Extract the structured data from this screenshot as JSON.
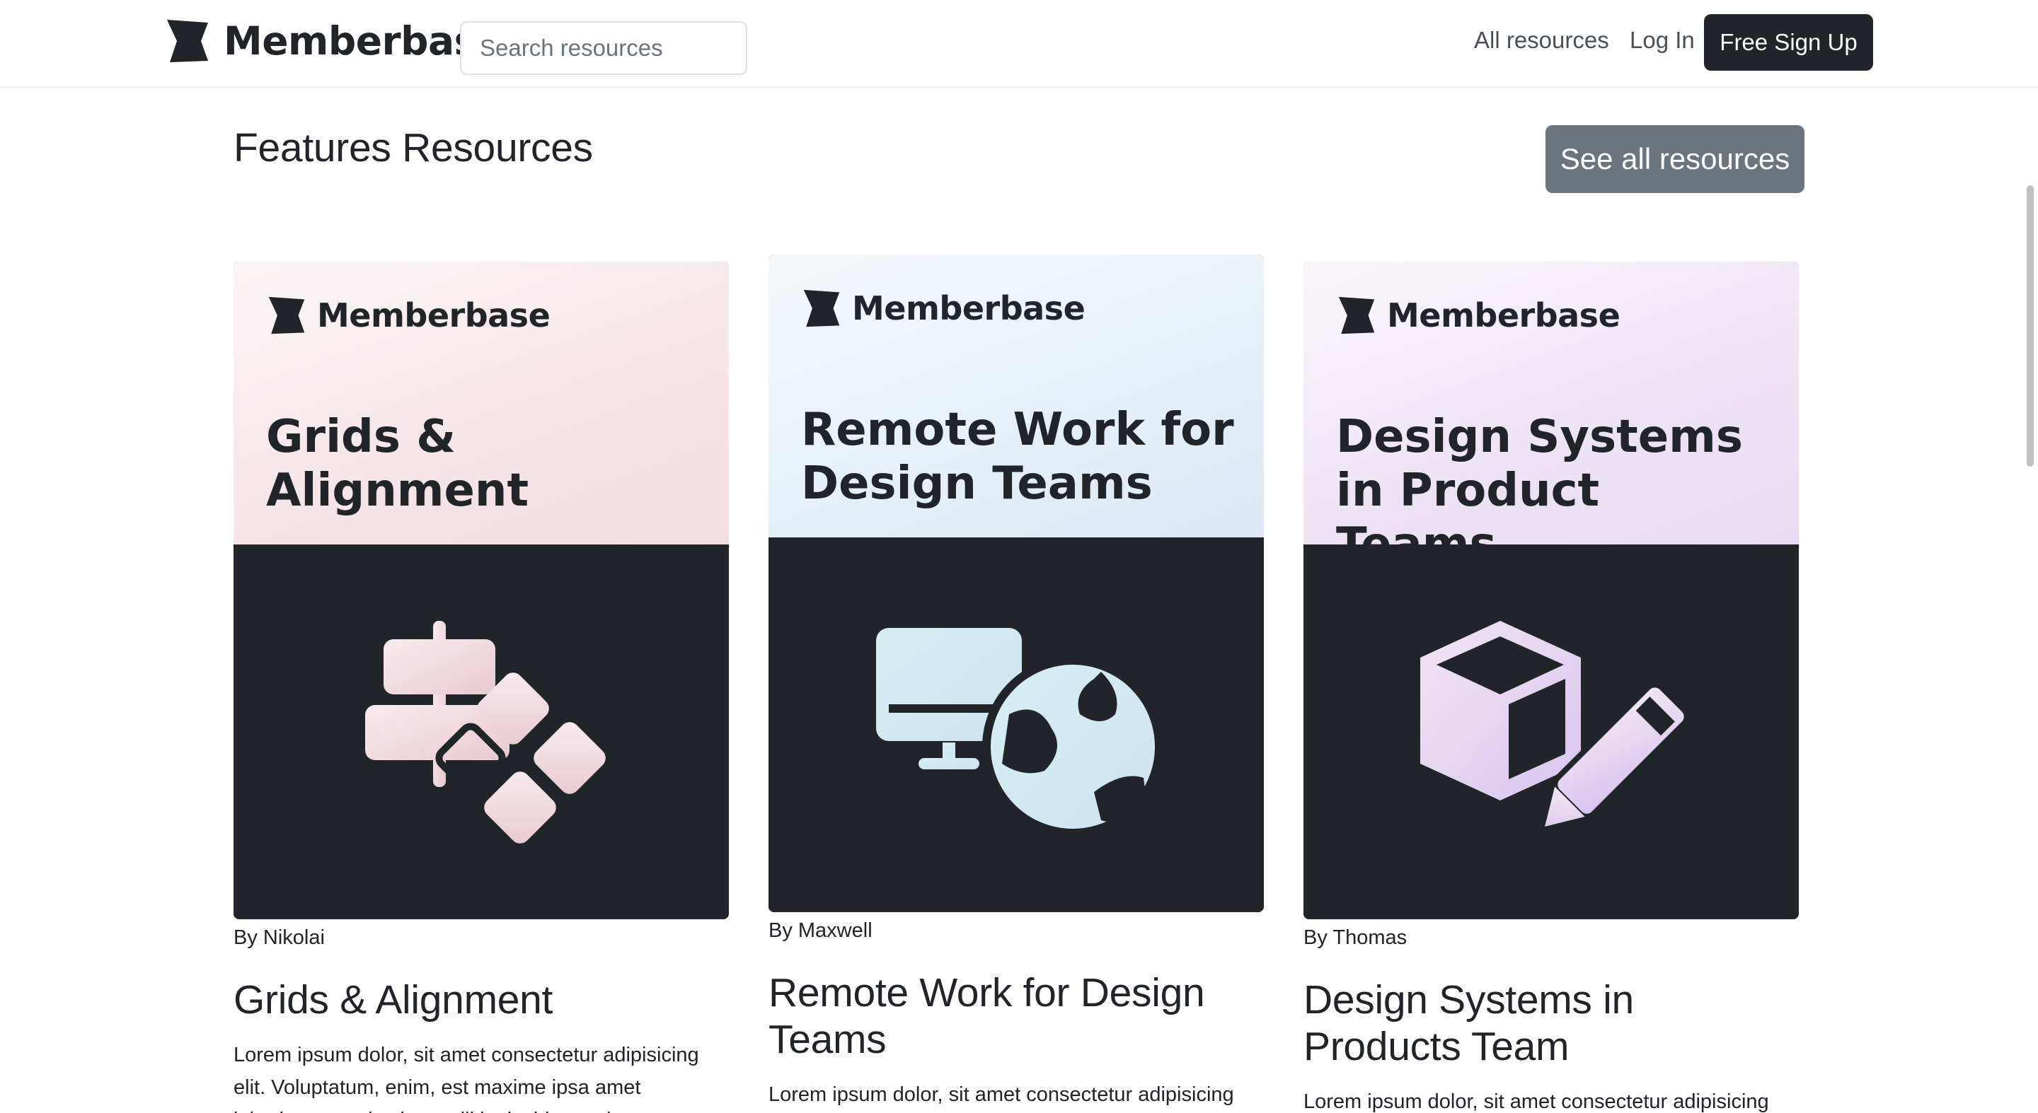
{
  "header": {
    "brand": "Memberbase",
    "search_placeholder": "Search resources",
    "nav_all_resources": "All resources",
    "nav_login": "Log In",
    "signup_label": "Free Sign Up"
  },
  "section": {
    "title": "Features Resources",
    "see_all_label": "See all resources"
  },
  "cards": [
    {
      "cover_brand": "Memberbase",
      "cover_title": "Grids & Alignment",
      "author": "By Nikolai",
      "title": "Grids & Alignment",
      "description": "Lorem ipsum dolor, sit amet consectetur adipisicing elit. Voluptatum, enim, est maxime ipsa amet laboriosam molestias mollitia, incidunt quis esse."
    },
    {
      "cover_brand": "Memberbase",
      "cover_title": "Remote Work for Design Teams",
      "author": "By Maxwell",
      "title": "Remote Work for Design Teams",
      "description": "Lorem ipsum dolor, sit amet consectetur adipisicing elit."
    },
    {
      "cover_brand": "Memberbase",
      "cover_title": "Design Systems in Product Teams",
      "author": "By Thomas",
      "title": "Design Systems in Products Team",
      "description": "Lorem ipsum dolor, sit amet consectetur adipisicing"
    }
  ],
  "colors": {
    "dark": "#212529",
    "secondary_button": "#6c757d",
    "pink_tint": "#f3dde1",
    "blue_tint": "#dde8f4",
    "purple_tint": "#e8dcf4"
  },
  "icons": {
    "brand": "memberbase-logo-icon",
    "card1": "alignment-shapes-icon",
    "card2": "monitor-globe-icon",
    "card3": "cube-pencil-icon"
  }
}
